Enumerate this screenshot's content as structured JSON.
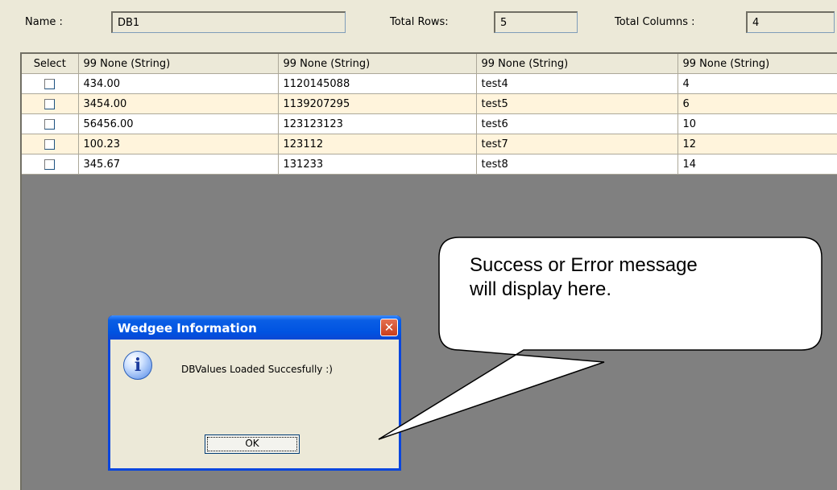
{
  "header": {
    "name_label": "Name :",
    "name_value": "DB1",
    "total_rows_label": "Total Rows:",
    "total_rows_value": "5",
    "total_columns_label": "Total Columns :",
    "total_columns_value": "4"
  },
  "grid": {
    "columns": [
      "Select",
      "99 None (String)",
      "99 None (String)",
      "99 None (String)",
      "99 None (String)"
    ],
    "rows": [
      [
        "434.00",
        "1120145088",
        "test4",
        "4"
      ],
      [
        "3454.00",
        "1139207295",
        "test5",
        "6"
      ],
      [
        "56456.00",
        "123123123",
        "test6",
        "10"
      ],
      [
        "100.23",
        "123112",
        "test7",
        "12"
      ],
      [
        "345.67",
        "131233",
        "test8",
        "14"
      ]
    ]
  },
  "dialog": {
    "title": "Wedgee Information",
    "message": "DBValues Loaded Succesfully :)",
    "ok_label": "OK",
    "close_glyph": "✕",
    "icon": "info-icon",
    "title_color": "#0053e1"
  },
  "callout": {
    "line1": "Success or Error message",
    "line2": "will display here."
  },
  "colors": {
    "panel_bg": "#ece9d8",
    "alt_row": "#fff4dc",
    "grid_empty": "#808080"
  }
}
